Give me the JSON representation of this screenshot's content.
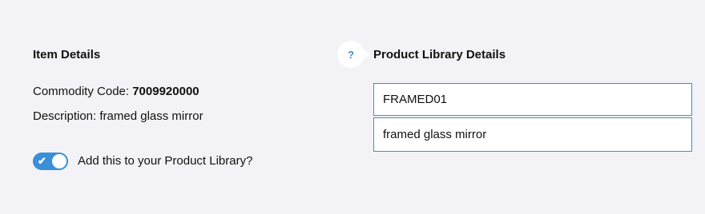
{
  "item_details": {
    "title": "Item Details",
    "commodity_label": "Commodity Code:",
    "commodity_value": "7009920000",
    "description_label": "Description:",
    "description_value": "framed glass mirror"
  },
  "product_library": {
    "title": "Product Library Details",
    "help_icon": "question-icon",
    "help_glyph": "?",
    "code_value": "FRAMED01",
    "description_value": "framed glass mirror"
  },
  "toggle": {
    "label": "Add this to your Product Library?",
    "checked": true,
    "check_glyph": "✔"
  },
  "colors": {
    "accent": "#3a8fd6",
    "background": "#f3f2f6"
  }
}
